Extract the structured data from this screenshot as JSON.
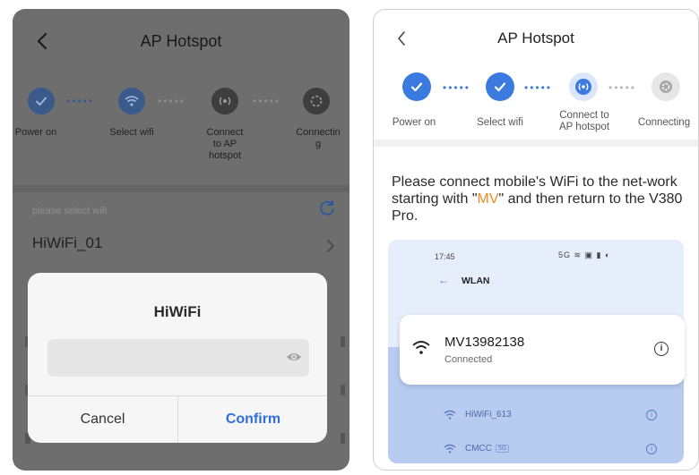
{
  "left": {
    "title": "AP Hotspot",
    "steps": [
      {
        "label": "Power on",
        "state": "done"
      },
      {
        "label": "Select wifi",
        "state": "active"
      },
      {
        "label": "Connect\nto AP\nhotspot",
        "state": "pending"
      },
      {
        "label": "Connectin\ng",
        "state": "pending"
      }
    ],
    "select_hint": "please select wifi",
    "wifi_row": "HiWiFi_01",
    "dialog": {
      "title": "HiWiFi",
      "password_value": "",
      "cancel_label": "Cancel",
      "confirm_label": "Confirm"
    }
  },
  "right": {
    "title": "AP Hotspot",
    "steps": [
      {
        "label": "Power on",
        "state": "done"
      },
      {
        "label": "Select wifi",
        "state": "done"
      },
      {
        "label": "Connect to\nAP hotspot",
        "state": "active"
      },
      {
        "label": "Connecting",
        "state": "pending"
      }
    ],
    "instruction_pre": "Please connect mobile's WiFi to the net-work starting with \"",
    "instruction_highlight": "MV",
    "instruction_post": "\" and then return to the V380 Pro.",
    "illustration": {
      "time": "17:45",
      "status_icons": "5G ≋ ▣ ▮ ◐",
      "header": "WLAN",
      "connected_network": "MV13982138",
      "connected_status": "Connected",
      "other_networks": [
        {
          "name": "HiWiFi_613",
          "tag": ""
        },
        {
          "name": "CMCC",
          "tag": "5G"
        }
      ]
    }
  },
  "colors": {
    "accent_blue": "#3b7be0",
    "highlight_orange": "#f08a24",
    "confirm_blue": "#2f6fd8"
  },
  "icons": {
    "back": "chevron-left-icon",
    "check": "check-icon",
    "wifi": "wifi-icon",
    "hotspot": "hotspot-icon",
    "connecting": "connecting-icon",
    "refresh": "refresh-icon",
    "chevron_right": "chevron-right-icon",
    "eye": "eye-icon",
    "info": "info-icon"
  }
}
